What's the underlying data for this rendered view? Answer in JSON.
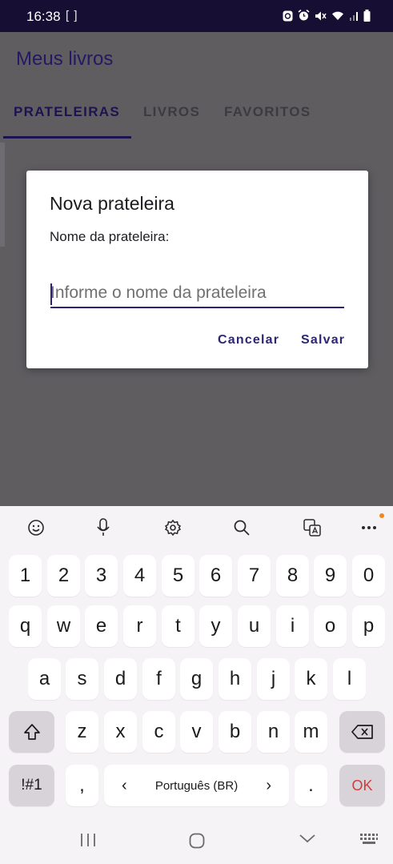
{
  "status_bar": {
    "time": "16:38",
    "brackets": "[ ]",
    "icons": [
      "sync-icon",
      "alarm-icon",
      "mute-icon",
      "wifi-icon",
      "signal-icon",
      "battery-icon"
    ]
  },
  "app": {
    "title": "Meus livros",
    "tabs": [
      {
        "label": "PRATELEIRAS",
        "active": true
      },
      {
        "label": "LIVROS",
        "active": false
      },
      {
        "label": "FAVORITOS",
        "active": false
      }
    ]
  },
  "dialog": {
    "title": "Nova prateleira",
    "label": "Nome da prateleira:",
    "input_value": "",
    "input_placeholder": "Informe o nome da prateleira",
    "cancel_label": "Cancelar",
    "save_label": "Salvar"
  },
  "keyboard": {
    "toolbar_icons": [
      "emoji-icon",
      "microphone-icon",
      "settings-icon",
      "search-icon",
      "translate-icon",
      "more-icon"
    ],
    "number_row": [
      "1",
      "2",
      "3",
      "4",
      "5",
      "6",
      "7",
      "8",
      "9",
      "0"
    ],
    "row1": [
      "q",
      "w",
      "e",
      "r",
      "t",
      "y",
      "u",
      "i",
      "o",
      "p"
    ],
    "row2": [
      "a",
      "s",
      "d",
      "f",
      "g",
      "h",
      "j",
      "k",
      "l"
    ],
    "row3": [
      "z",
      "x",
      "c",
      "v",
      "b",
      "n",
      "m"
    ],
    "symbols_label": "!#1",
    "comma_label": ",",
    "space_label": "Português (BR)",
    "space_left_arrow": "‹",
    "space_right_arrow": "›",
    "period_label": ".",
    "ok_label": "OK"
  },
  "colors": {
    "status_bar": "#170f33",
    "accent": "#2c2574",
    "scrim": "#5f5d60",
    "keyboard_bg": "#f6f3f6",
    "ok_key": "#d43a3a"
  }
}
